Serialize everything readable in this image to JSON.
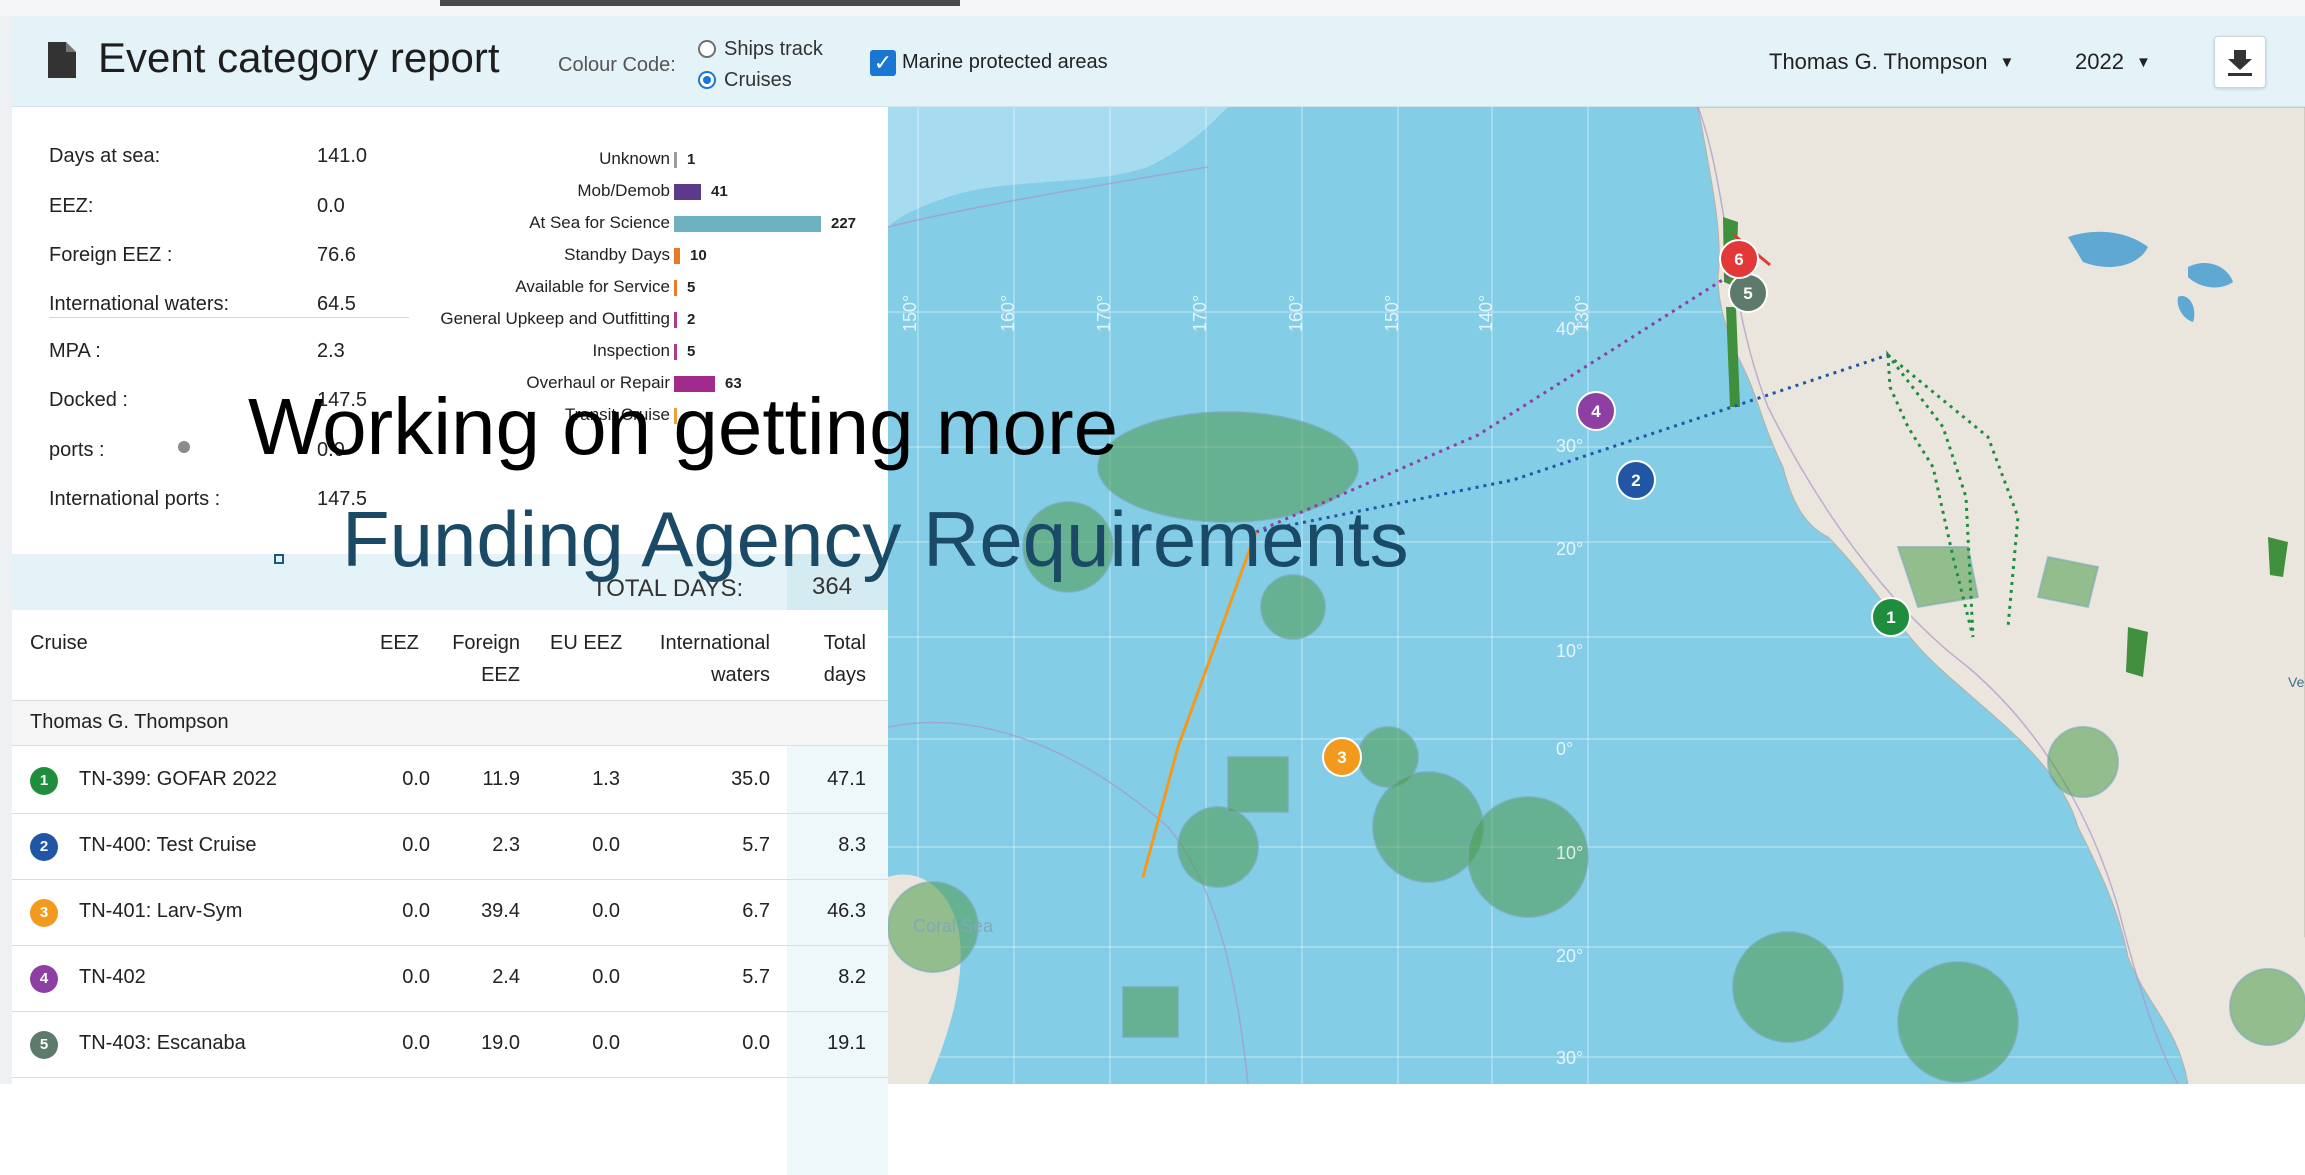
{
  "header": {
    "title": "Event category report",
    "colour_code_label": "Colour Code:",
    "options": [
      "Ships track",
      "Cruises"
    ],
    "selected_option": "Cruises",
    "mpa_label": "Marine protected areas",
    "mpa_checked": true,
    "vessel": "Thomas G. Thompson",
    "year": "2022"
  },
  "stats": [
    {
      "label": "Days at sea:",
      "value": "141.0"
    },
    {
      "label": "EEZ:",
      "value": "0.0"
    },
    {
      "label": "Foreign EEZ :",
      "value": "76.6"
    },
    {
      "label": "International waters:",
      "value": "64.5"
    },
    {
      "label": "MPA :",
      "value": "2.3"
    },
    {
      "label": "Docked :",
      "value": "147.5"
    },
    {
      "label": "ports :",
      "value": "0.0"
    },
    {
      "label": "International ports :",
      "value": "147.5"
    }
  ],
  "chart_data": {
    "type": "bar",
    "orientation": "horizontal",
    "categories": [
      "Unknown",
      "Mob/Demob",
      "At Sea for Science",
      "Standby Days",
      "Available for Service",
      "General Upkeep and Outfitting",
      "Inspection",
      "Overhaul or Repair",
      "Transit Cruise"
    ],
    "values": [
      1,
      41,
      227,
      10,
      5,
      2,
      5,
      63,
      null
    ],
    "colors": [
      "#9b9b9b",
      "#5b3a8c",
      "#6eb2c2",
      "#e87a2c",
      "#e87a2c",
      "#b03a8c",
      "#b03a8c",
      "#a12b8c",
      "#e8a33c"
    ]
  },
  "totals": {
    "label": "TOTAL DAYS:",
    "value": "364"
  },
  "table": {
    "columns": [
      "Cruise",
      "EEZ",
      "Foreign EEZ",
      "EU EEZ",
      "International waters",
      "Total days"
    ],
    "group": "Thomas G. Thompson",
    "rows": [
      {
        "num": "1",
        "color": "#1e8e3e",
        "name": "TN-399: GOFAR 2022",
        "eez": "0.0",
        "foreign": "11.9",
        "eu": "1.3",
        "intl": "35.0",
        "total": "47.1"
      },
      {
        "num": "2",
        "color": "#2156a5",
        "name": "TN-400: Test Cruise",
        "eez": "0.0",
        "foreign": "2.3",
        "eu": "0.0",
        "intl": "5.7",
        "total": "8.3"
      },
      {
        "num": "3",
        "color": "#f29a1e",
        "name": "TN-401: Larv-Sym",
        "eez": "0.0",
        "foreign": "39.4",
        "eu": "0.0",
        "intl": "6.7",
        "total": "46.3"
      },
      {
        "num": "4",
        "color": "#8e3fa3",
        "name": "TN-402",
        "eez": "0.0",
        "foreign": "2.4",
        "eu": "0.0",
        "intl": "5.7",
        "total": "8.2"
      },
      {
        "num": "5",
        "color": "#5d7a6a",
        "name": "TN-403: Escanaba",
        "eez": "0.0",
        "foreign": "19.0",
        "eu": "0.0",
        "intl": "0.0",
        "total": "19.1"
      }
    ]
  },
  "map": {
    "longitude_labels": [
      "150°",
      "160°",
      "170°",
      "170°",
      "160°",
      "150°",
      "140°",
      "130°"
    ],
    "latitude_labels": [
      "40°",
      "30°",
      "20°",
      "10°",
      "0°",
      "10°",
      "20°",
      "30°"
    ],
    "sea_label": "Coral Sea",
    "edge_label": "Ve",
    "markers": [
      "1",
      "2",
      "3",
      "4",
      "5",
      "6"
    ]
  },
  "overlay": {
    "line1": "Working on getting more",
    "line2": "Funding Agency Requirements"
  }
}
